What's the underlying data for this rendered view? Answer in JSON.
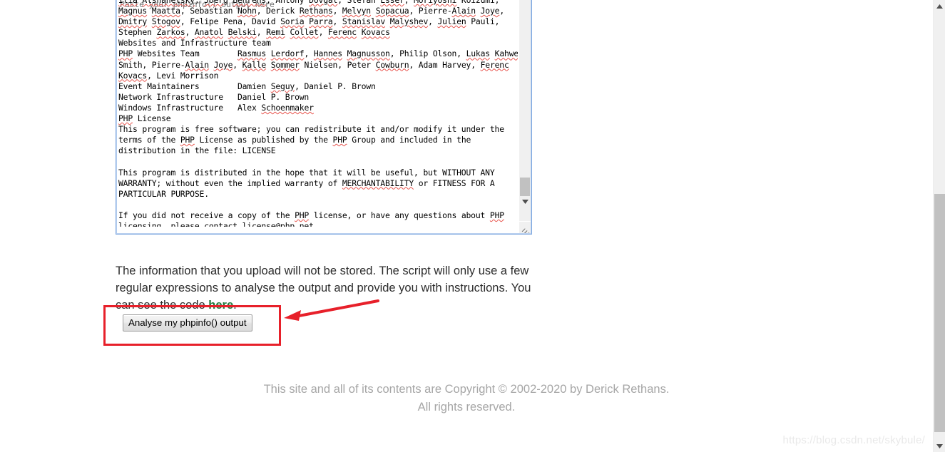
{
  "page": {
    "background": "#ffffff",
    "watermark": "https://blog.csdn.net/skybule/"
  },
  "textarea": {
    "name": "phpinfo-output-textarea",
    "border_color": "#7fa8e0",
    "placeholder": "Paste your phpinfo() output here",
    "lines": [
      "Ilia Alshanetsky, Joerg Behrens, Antony Dovgal, Stefan Esser, Moriyoshi Koizumi,",
      "Magnus Maatta, Sebastian Nohn, Derick Rethans, Melvyn Sopacua, Pierre-Alain Joye,",
      "Dmitry Stogov, Felipe Pena, David Soria Parra, Stanislav Malyshev, Julien Pauli,",
      "Stephen Zarkos, Anatol Belski, Remi Collet, Ferenc Kovacs",
      "Websites and Infrastructure team",
      "PHP Websites Team        Rasmus Lerdorf, Hannes Magnusson, Philip Olson, Lukas Kahwe",
      "Smith, Pierre-Alain Joye, Kalle Sommer Nielsen, Peter Cowburn, Adam Harvey, Ferenc",
      "Kovacs, Levi Morrison",
      "Event Maintainers        Damien Seguy, Daniel P. Brown",
      "Network Infrastructure   Daniel P. Brown",
      "Windows Infrastructure   Alex Schoenmaker",
      "PHP License",
      "This program is free software; you can redistribute it and/or modify it under the",
      "terms of the PHP License as published by the PHP Group and included in the",
      "distribution in the file: LICENSE",
      "",
      "This program is distributed in the hope that it will be useful, but WITHOUT ANY",
      "WARRANTY; without even the implied warranty of MERCHANTABILITY or FITNESS FOR A",
      "PARTICULAR PURPOSE.",
      "",
      "If you did not receive a copy of the PHP license, or have any questions about PHP",
      "licensing, please contact license@php.net."
    ],
    "scrollbar": {
      "down_arrow_icon": "chevron-down-icon",
      "resize_grip_icon": "resize-grip-icon"
    }
  },
  "blurb": {
    "part1": "The information that you upload will not be stored. The script will only use a few regular expressions to analyse the output and provide you with instructions. You can see the code ",
    "link_label": "here",
    "link_color": "#1f7a3d",
    "part2": "."
  },
  "analyse_button": {
    "label": "Analyse my phpinfo() output"
  },
  "annotation": {
    "box_color": "#e7202a",
    "arrow_color": "#e7202a",
    "arrow_icon": "arrow-left-icon"
  },
  "footer": {
    "line1": "This site and all of its contents are Copyright © 2002-2020 by Derick Rethans.",
    "line2": "All rights reserved."
  },
  "page_scrollbar": {
    "up_arrow_icon": "chevron-up-icon",
    "down_arrow_icon": "chevron-down-icon"
  }
}
